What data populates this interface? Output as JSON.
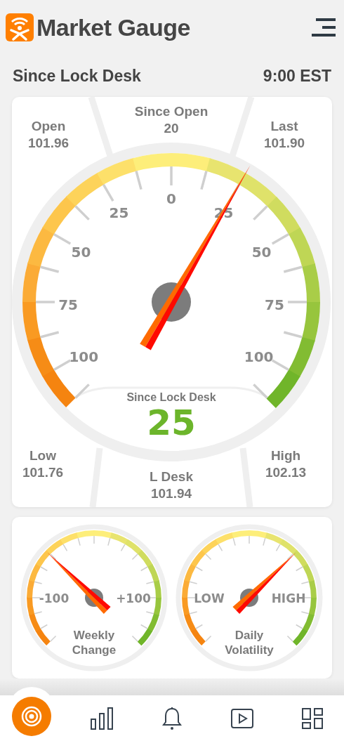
{
  "header": {
    "title": "Market Gauge"
  },
  "subheader": {
    "label": "Since Lock Desk",
    "time": "9:00 EST"
  },
  "main_gauge": {
    "stats": [
      {
        "label": "Open",
        "value": "101.96"
      },
      {
        "label": "Since Open",
        "value": "20"
      },
      {
        "label": "Last",
        "value": "101.90"
      },
      {
        "label": "Low",
        "value": "101.76"
      },
      {
        "label": "L Desk",
        "value": "101.94"
      },
      {
        "label": "High",
        "value": "102.13"
      }
    ],
    "scale_labels": [
      "100",
      "75",
      "50",
      "25",
      "0",
      "25",
      "50",
      "75",
      "100"
    ],
    "reading_label": "Since Lock Desk",
    "reading": "25"
  },
  "mini_gauges": [
    {
      "left_label": "-100",
      "right_label": "+100",
      "caption": "Weekly Change"
    },
    {
      "left_label": "LOW",
      "right_label": "HIGH",
      "caption": "Daily Volatility"
    }
  ],
  "nav": [
    {
      "kind": "target",
      "selected": true
    },
    {
      "kind": "chart",
      "selected": false
    },
    {
      "kind": "bell",
      "selected": false
    },
    {
      "kind": "play",
      "selected": false
    },
    {
      "kind": "grid",
      "selected": false
    }
  ]
}
